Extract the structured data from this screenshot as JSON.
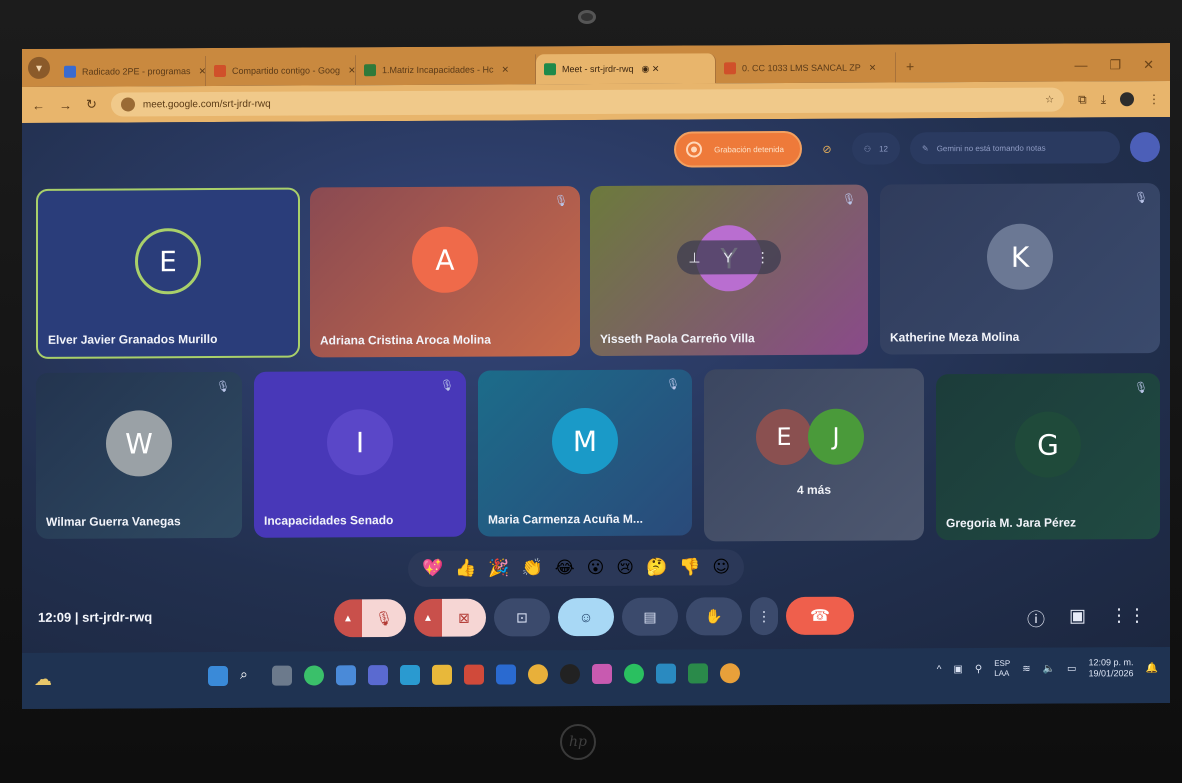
{
  "browser": {
    "tabs": [
      {
        "label": "Radicado 2PE - programas",
        "color": "#3a6bd0"
      },
      {
        "label": "Compartido contigo - Goog",
        "color": "#d0502a"
      },
      {
        "label": "1.Matriz Incapacidades - Hc",
        "color": "#2f7a3a"
      },
      {
        "label": "Meet - srt-jrdr-rwq",
        "color": "#1f8a4a",
        "active": true
      },
      {
        "label": "0. CC 1033 LMS SANCAL ZP",
        "color": "#d0502a"
      }
    ],
    "url": "meet.google.com/srt-jrdr-rwq"
  },
  "meet": {
    "recording_label": "Grabación detenida",
    "people_count": "12",
    "gemini_label": "Gemini no está tomando notas",
    "participants": [
      {
        "name": "Elver Javier Granados Murillo",
        "initial": "E"
      },
      {
        "name": "Adriana Cristina Aroca Molina",
        "initial": "A"
      },
      {
        "name": "Yisseth Paola Carreño Villa",
        "initial": "Y"
      },
      {
        "name": "Katherine Meza Molina",
        "initial": "K"
      },
      {
        "name": "Wilmar Guerra Vanegas",
        "initial": "W"
      },
      {
        "name": "Incapacidades Senado",
        "initial": "I"
      },
      {
        "name": "Maria Carmenza Acuña M...",
        "initial": "M"
      },
      {
        "name": "Gregoria M. Jara Pérez",
        "initial": "G"
      }
    ],
    "more": {
      "initials": [
        "E",
        "J"
      ],
      "label": "4 más"
    },
    "reactions": [
      "💖",
      "👍",
      "🎉",
      "👏",
      "😂",
      "😮",
      "😢",
      "🤔",
      "👎",
      "☺"
    ],
    "meeting_time": "12:09",
    "meeting_code": "srt-jrdr-rwq"
  },
  "taskbar": {
    "lang_top": "ESP",
    "lang_bottom": "LAA",
    "time": "12:09 p. m.",
    "date": "19/01/2026"
  },
  "laptop_brand": "hp"
}
